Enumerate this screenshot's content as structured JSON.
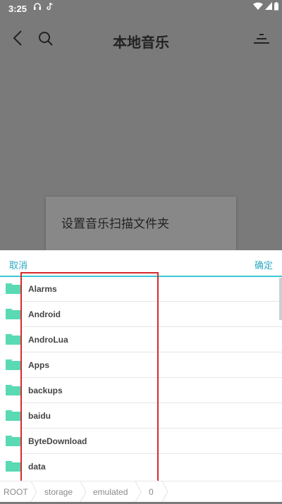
{
  "status": {
    "time": "3:25"
  },
  "header": {
    "title": "本地音乐"
  },
  "dialog": {
    "title": "设置音乐扫描文件夹"
  },
  "sheet": {
    "cancel": "取消",
    "confirm": "确定",
    "folders": [
      "Alarms",
      "Android",
      "AndroLua",
      "Apps",
      "backups",
      "baidu",
      "ByteDownload",
      "data"
    ]
  },
  "breadcrumb": [
    "ROOT",
    "storage",
    "emulated",
    "0"
  ],
  "colors": {
    "accent": "#2aa8c4",
    "folder": "#59d9b4",
    "highlight": "#d62b2b"
  }
}
